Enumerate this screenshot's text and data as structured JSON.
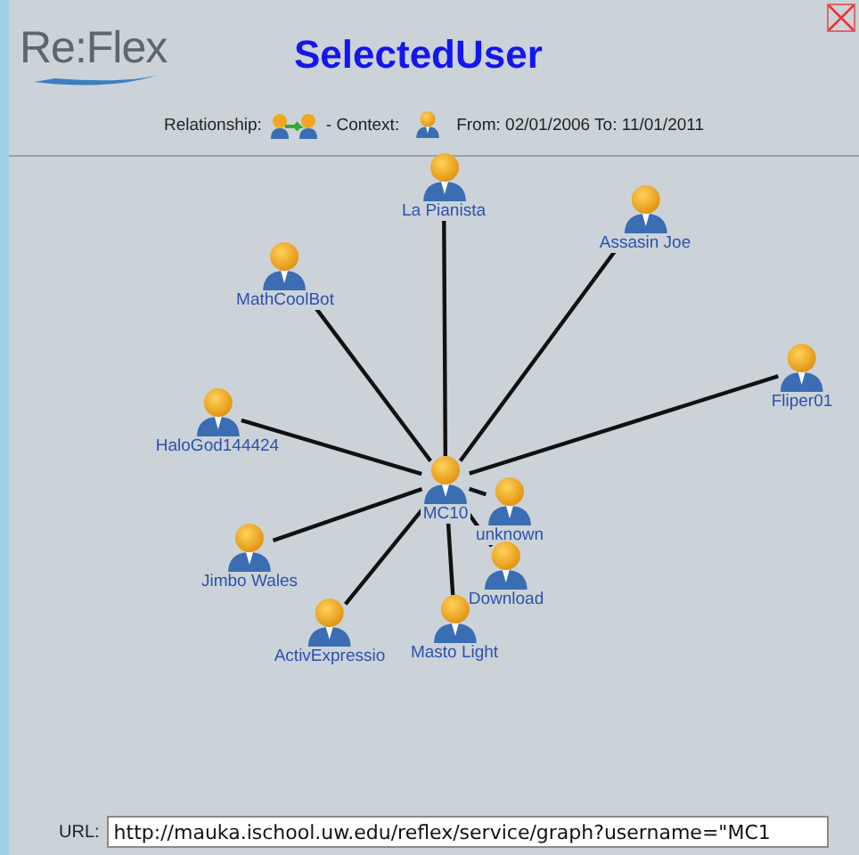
{
  "header": {
    "logo": "Re:Flex",
    "title": "SelectedUser",
    "relationship_label": "Relationship:",
    "context_label": "- Context:",
    "date_range": "From: 02/01/2006 To: 11/01/2011"
  },
  "graph": {
    "nodes": [
      {
        "label": "La Pianista",
        "kind": "user"
      },
      {
        "label": "Assasin Joe",
        "kind": "user"
      },
      {
        "label": "MathCoolBot",
        "kind": "user"
      },
      {
        "label": "HaloGod144424",
        "kind": "user"
      },
      {
        "label": "Fliper01",
        "kind": "user"
      },
      {
        "label": "MC10",
        "kind": "center"
      },
      {
        "label": "unknown",
        "kind": "user"
      },
      {
        "label": "Download",
        "kind": "user"
      },
      {
        "label": "Jimbo Wales",
        "kind": "user"
      },
      {
        "label": "ActivExpressio",
        "kind": "user"
      },
      {
        "label": "Masto Light",
        "kind": "user"
      }
    ]
  },
  "url": {
    "label": "URL:",
    "value": "http://mauka.ischool.uw.edu/reflex/service/graph?username=\"MC1"
  }
}
